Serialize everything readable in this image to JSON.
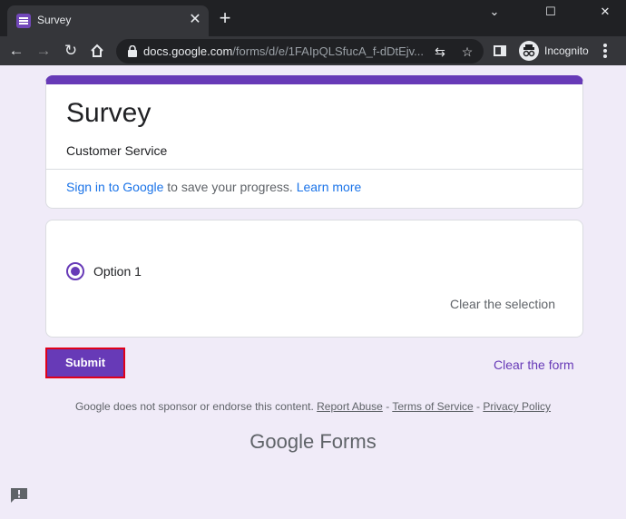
{
  "browser": {
    "tab_title": "Survey",
    "tab_close": "✕",
    "new_tab": "+",
    "url_domain": "docs.google.com",
    "url_path": "/forms/d/e/1FAIpQLSfucA_f-dDtEjv...",
    "incognito_label": "Incognito",
    "window_minimize": "⌄",
    "window_restore": "☐",
    "window_close": "✕"
  },
  "form": {
    "title": "Survey",
    "description": "Customer Service",
    "signin_link": "Sign in to Google",
    "signin_rest": " to save your progress. ",
    "learn_more": "Learn more",
    "option_label": "Option 1",
    "option_selected": true,
    "clear_selection": "Clear the selection",
    "submit": "Submit",
    "clear_form": "Clear the form"
  },
  "footer": {
    "disclaimer": "Google does not sponsor or endorse this content. ",
    "report_abuse": "Report Abuse",
    "sep1": " - ",
    "terms": "Terms of Service",
    "sep2": " - ",
    "privacy": "Privacy Policy",
    "brand_google": "Google",
    "brand_forms": " Forms"
  },
  "colors": {
    "accent": "#673ab7",
    "link": "#1a73e8",
    "background": "#f0ebf8",
    "highlight_border": "#e0001a"
  },
  "icons": [
    "forms-icon",
    "back-icon",
    "forward-icon",
    "reload-icon",
    "home-icon",
    "lock-icon",
    "translate-icon",
    "star-icon",
    "side-panel-icon",
    "incognito-icon",
    "menu-icon",
    "feedback-icon"
  ]
}
